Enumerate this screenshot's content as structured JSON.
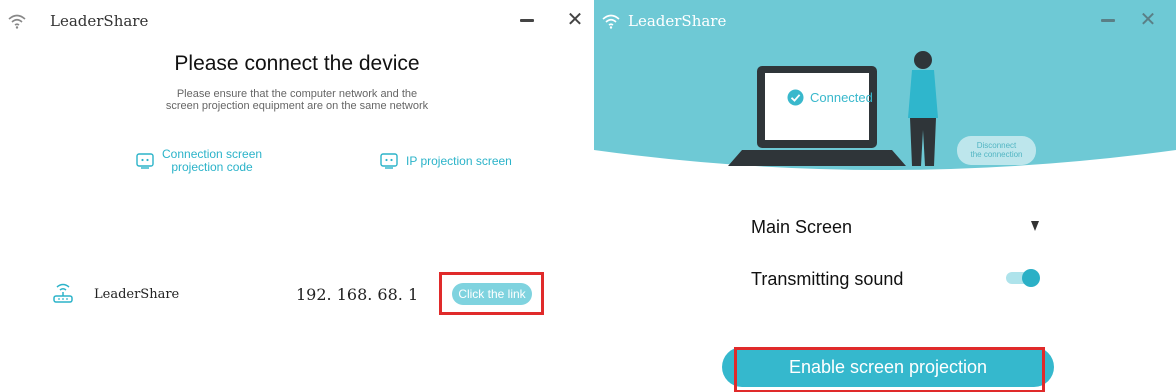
{
  "left": {
    "app_title": "LeaderShare",
    "heading": "Please connect the device",
    "subtitle_line1": "Please ensure that the computer network and the",
    "subtitle_line2": "screen projection equipment are on the same network",
    "options": {
      "code_line1": "Connection screen",
      "code_line2": "projection code",
      "ip": "IP projection screen"
    },
    "device": {
      "name": "LeaderShare",
      "ip": "192. 168. 68. 1",
      "link_label": "Click the link"
    }
  },
  "right": {
    "app_title": "LeaderShare",
    "status": "Connected",
    "disconnect_line1": "Disconnect",
    "disconnect_line2": "the connection",
    "main_screen_label": "Main Screen",
    "sound_label": "Transmitting sound",
    "sound_enabled": true,
    "enable_button": "Enable screen projection"
  },
  "colors": {
    "accent": "#35b8cd",
    "hero_bg": "#6ec9d5",
    "highlight": "#e02a2a"
  }
}
